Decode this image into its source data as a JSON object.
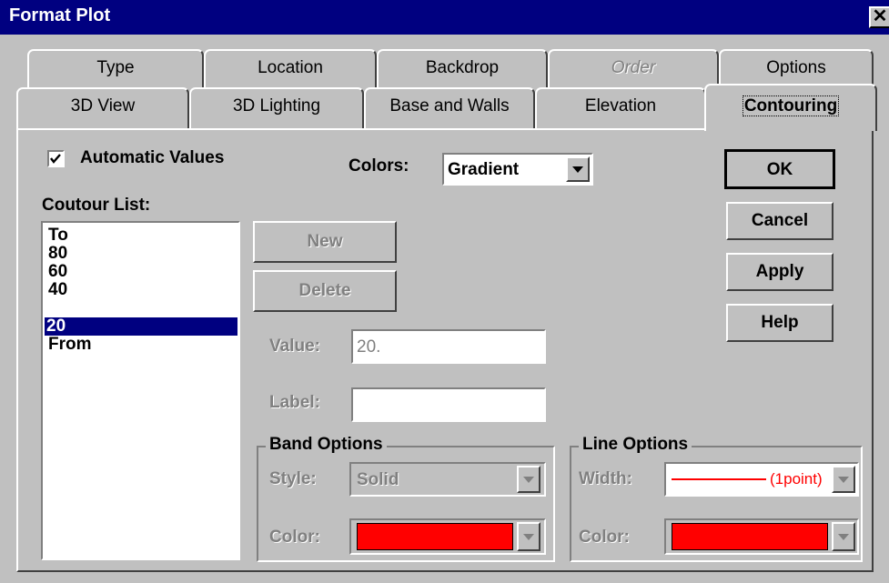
{
  "window": {
    "title": "Format Plot",
    "close_glyph": "✕"
  },
  "tabs_back": [
    "Type",
    "Location",
    "Backdrop",
    "Order",
    "Options"
  ],
  "tabs_front": [
    "3D View",
    "3D Lighting",
    "Base and Walls",
    "Elevation",
    "Contouring"
  ],
  "active_tab": "Contouring",
  "automatic_values": {
    "label": "Automatic Values",
    "checked": true
  },
  "colors": {
    "label": "Colors:",
    "value": "Gradient"
  },
  "contour_list": {
    "label": "Coutour List:",
    "items": [
      "To",
      "80",
      "60",
      "40",
      "20",
      "From"
    ],
    "selected": "20"
  },
  "buttons": {
    "new": "New",
    "delete": "Delete",
    "ok": "OK",
    "cancel": "Cancel",
    "apply": "Apply",
    "help": "Help"
  },
  "value_field": {
    "label": "Value:",
    "value": "20."
  },
  "label_field": {
    "label": "Label:",
    "value": ""
  },
  "band_options": {
    "title": "Band Options",
    "style_label": "Style:",
    "style_value": "Solid",
    "color_label": "Color:",
    "color_value": "#ff0000"
  },
  "line_options": {
    "title": "Line Options",
    "width_label": "Width:",
    "width_value": "(1point)",
    "color_label": "Color:",
    "color_value": "#ff0000"
  }
}
